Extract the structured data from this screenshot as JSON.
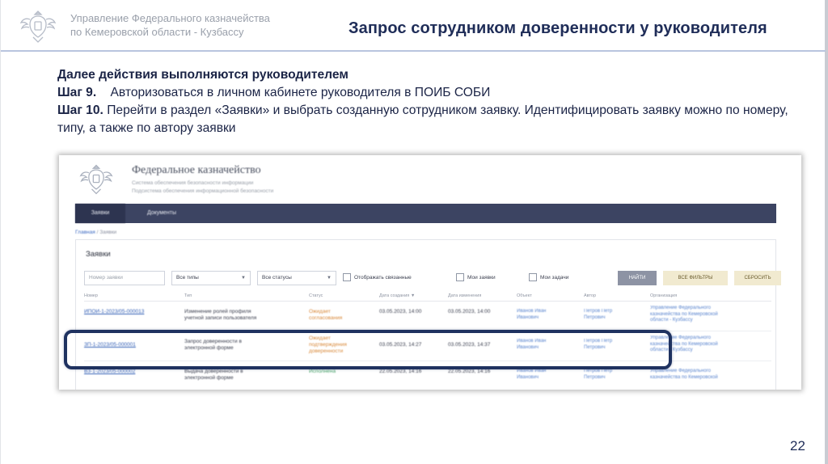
{
  "header": {
    "org_line1": "Управление Федерального казначейства",
    "org_line2": "по Кемеровской области - Кузбассу",
    "title": "Запрос сотрудником доверенности у руководителя"
  },
  "instructions": {
    "lead": "Далее действия выполняются руководителем",
    "step9_label": "Шаг 9.",
    "step9_text": "Авторизоваться в личном кабинете руководителя в ПОИБ СОБИ",
    "step10_label": "Шаг 10.",
    "step10_text": "Перейти в раздел «Заявки» и выбрать созданную сотрудником заявку. Идентифицировать заявку можно по номеру, типу, а также по автору заявки"
  },
  "screenshot": {
    "site_title": "Федеральное казначейство",
    "site_sub1": "Система обеспечения безопасности информации",
    "site_sub2": "Подсистема обеспечения информационной безопасности",
    "nav": {
      "item1": "Заявки",
      "item2": "Документы"
    },
    "breadcrumbs": {
      "home": "Главная",
      "separator": "/",
      "current": "Заявки"
    },
    "panel_title": "Заявки",
    "filters": {
      "number_placeholder": "Номер заявки",
      "type_value": "Все типы",
      "status_value": "Все статусы",
      "check_related": "Отображать связанные",
      "check_mine": "Мои заявки",
      "check_assigned": "Мои задачи",
      "find_label": "НАЙТИ",
      "more_label": "ВСЕ ФИЛЬТРЫ",
      "reset_label": "СБРОСИТЬ"
    },
    "columns": [
      "Номер",
      "Тип",
      "Статус",
      "Дата создания",
      "Дата изменения",
      "Объект",
      "Автор",
      "Организация"
    ],
    "rows": [
      {
        "number": "ИПОИ-1-2023/05-000013",
        "type_line1": "Изменение ролей профиля",
        "type_line2": "учетной записи пользователя",
        "status_line1": "Ожидает",
        "status_line2": "согласования",
        "created": "03.05.2023, 14:00",
        "updated": "03.05.2023, 14:00",
        "object_line1": "Иванов Иван",
        "object_line2": "Иванович",
        "author_line1": "Петров Петр",
        "author_line2": "Петрович",
        "org_line1": "Управление Федерального",
        "org_line2": "казначейства по Кемеровской",
        "org_line3": "области - Кузбассу",
        "status_color": "orange"
      },
      {
        "number": "ЗП-1-2023/05-000001",
        "type_line1": "Запрос доверенности в",
        "type_line2": "электронной форме",
        "status_line1": "Ожидает",
        "status_line2": "подтверждения",
        "status_line3": "доверенности",
        "created": "03.05.2023, 14:27",
        "updated": "03.05.2023, 14:37",
        "object_line1": "Иванов Иван",
        "object_line2": "Иванович",
        "author_line1": "Петров Петр",
        "author_line2": "Петрович",
        "org_line1": "Управление Федерального",
        "org_line2": "казначейства по Кемеровской",
        "org_line3": "области - Кузбассу",
        "status_color": "orange"
      },
      {
        "number": "ВЗ-1-2023/05-000002",
        "type_line1": "Выдача доверенности в",
        "type_line2": "электронной форме",
        "status_line1": "Исполнена",
        "created": "22.05.2023, 14:16",
        "updated": "22.05.2023, 14:16",
        "object_line1": "Иванов Иван",
        "object_line2": "Иванович",
        "author_line1": "Петров Петр",
        "author_line2": "Петрович",
        "org_line1": "Управление Федерального",
        "org_line2": "казначейства по Кемеровской",
        "status_color": "green"
      }
    ]
  },
  "page_number": "22",
  "colors": {
    "title": "#1f2d58",
    "nav_bar": "#3c4462",
    "highlight": "#1f3260",
    "status_orange": "#d98a3c",
    "status_green": "#47a36a"
  }
}
